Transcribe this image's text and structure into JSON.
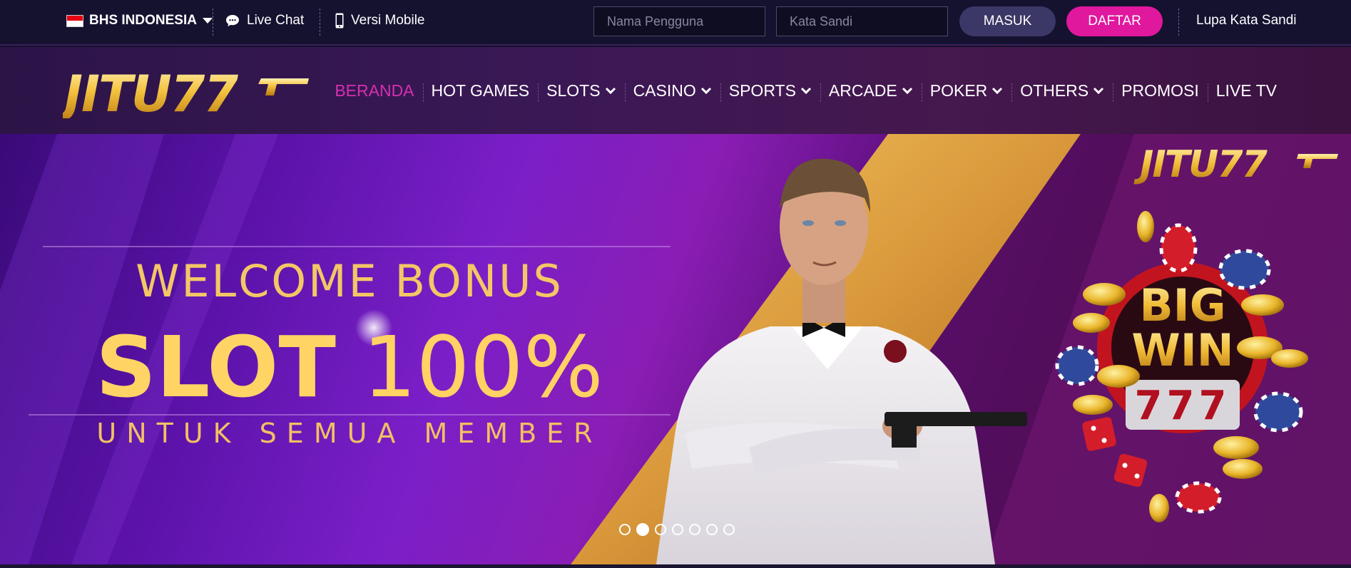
{
  "topbar": {
    "language": "BHS INDONESIA",
    "live_chat": "Live Chat",
    "mobile_version": "Versi Mobile",
    "username_placeholder": "Nama Pengguna",
    "password_placeholder": "Kata Sandi",
    "login_label": "MASUK",
    "register_label": "DAFTAR",
    "forgot_password": "Lupa Kata Sandi"
  },
  "logo": {
    "text": "JITU77"
  },
  "nav": {
    "items": [
      {
        "label": "BERANDA",
        "active": true,
        "dropdown": false
      },
      {
        "label": "HOT GAMES",
        "dropdown": false
      },
      {
        "label": "SLOTS",
        "dropdown": true
      },
      {
        "label": "CASINO",
        "dropdown": true
      },
      {
        "label": "SPORTS",
        "dropdown": true
      },
      {
        "label": "ARCADE",
        "dropdown": true
      },
      {
        "label": "POKER",
        "dropdown": true
      },
      {
        "label": "OTHERS",
        "dropdown": true
      },
      {
        "label": "PROMOSI",
        "dropdown": false
      },
      {
        "label": "LIVE TV",
        "dropdown": false
      }
    ]
  },
  "banner": {
    "line1": "WELCOME BONUS",
    "line2_bold": "SLOT",
    "line2_light": "100%",
    "line3": "UNTUK SEMUA MEMBER",
    "logo_text": "JITU77",
    "badge_top": "BIG",
    "badge_bottom": "WIN",
    "reels": "777",
    "slide_count": 7,
    "active_slide": 2
  },
  "colors": {
    "accent_pink": "#e0189e",
    "gold": "#ffd465",
    "active_nav": "#d62fb0",
    "topbar_bg": "#151230"
  }
}
